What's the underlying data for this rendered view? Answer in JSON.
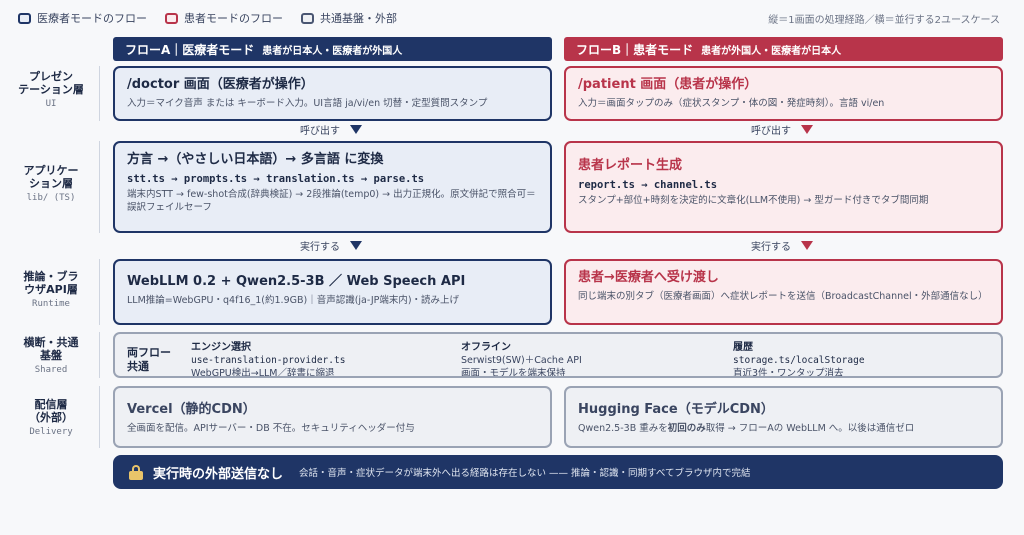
{
  "legend": {
    "items": [
      {
        "label": "医療者モードのフロー",
        "color": "#1f3566"
      },
      {
        "label": "患者モードのフロー",
        "color": "#b8344a"
      },
      {
        "label": "共通基盤・外部",
        "color": "#4a5672"
      }
    ],
    "note": "縦＝1画面の処理経路／横＝並行する2ユースケース"
  },
  "flows": {
    "a": {
      "title": "フローA｜医療者モード",
      "subtitle": "患者が日本人・医療者が外国人",
      "color": "#1f3566"
    },
    "b": {
      "title": "フローB｜患者モード",
      "subtitle": "患者が外国人・医療者が日本人",
      "color": "#b8344a"
    }
  },
  "layers": [
    {
      "name": "プレゼン\nテーション層",
      "sub": "UI"
    },
    {
      "name": "アプリケー\nション層",
      "sub": "lib/ (TS)"
    },
    {
      "name": "推論・ブラ\nウザAPI層",
      "sub": "Runtime"
    },
    {
      "name": "横断・共通\n基盤",
      "sub": "Shared"
    },
    {
      "name": "配信層\n（外部）",
      "sub": "Delivery"
    }
  ],
  "ui": {
    "a": {
      "title": "/doctor 画面（医療者が操作）",
      "desc": "入力＝マイク音声 または キーボード入力。UI言語 ja/vi/en 切替・定型質問スタンプ"
    },
    "b": {
      "title": "/patient 画面（患者が操作）",
      "desc": "入力＝画面タップのみ（症状スタンプ・体の図・発症時刻）。言語 vi/en"
    }
  },
  "connectors": {
    "call": "呼び出す",
    "exec": "実行する"
  },
  "app": {
    "a": {
      "title": "方言 →（やさしい日本語）→ 多言語 に変換",
      "code": "stt.ts → prompts.ts → translation.ts → parse.ts",
      "desc": "端末内STT → few-shot合成(辞典検証) → 2段推論(temp0) → 出力正規化。原文併記で照合可＝誤訳フェイルセーフ"
    },
    "b": {
      "title": "患者レポート生成",
      "code": "report.ts → channel.ts",
      "desc": "スタンプ+部位+時刻を決定的に文章化(LLM不使用) → 型ガード付きでタブ間同期"
    }
  },
  "runtime": {
    "a": {
      "title": "WebLLM 0.2 + Qwen2.5-3B ／ Web Speech API",
      "desc": "LLM推論=WebGPU・q4f16_1(約1.9GB)｜音声認識(ja-JP端末内)・読み上げ"
    },
    "b": {
      "title": "患者→医療者へ受け渡し",
      "desc": "同じ端末の別タブ（医療者画面）へ症状レポートを送信（BroadcastChannel・外部通信なし）"
    }
  },
  "shared": {
    "title": "両フロー\n共通",
    "cols": [
      {
        "head": "エンジン選択",
        "code": "use-translation-provider.ts",
        "desc": "WebGPU検出→LLM／辞書に縮退"
      },
      {
        "head": "オフライン",
        "code": "Serwist9(SW)＋Cache API",
        "desc": "画面・モデルを端末保持"
      },
      {
        "head": "履歴",
        "code": "storage.ts/localStorage",
        "desc": "直近3件・ワンタップ消去"
      }
    ]
  },
  "delivery": {
    "a": {
      "title": "Vercel（静的CDN）",
      "desc": "全画面を配信。APIサーバー・DB 不在。セキュリティヘッダー付与"
    },
    "b": {
      "title": "Hugging Face（モデルCDN）",
      "desc_pre": "Qwen2.5-3B 重みを",
      "desc_bold": "初回のみ",
      "desc_post": "取得 → フローAの WebLLM へ。以後は通信ゼロ"
    }
  },
  "banner": {
    "title": "実行時の外部送信なし",
    "sub": "会話・音声・症状データが端末外へ出る経路は存在しない —— 推論・認識・同期すべてブラウザ内で完結"
  }
}
